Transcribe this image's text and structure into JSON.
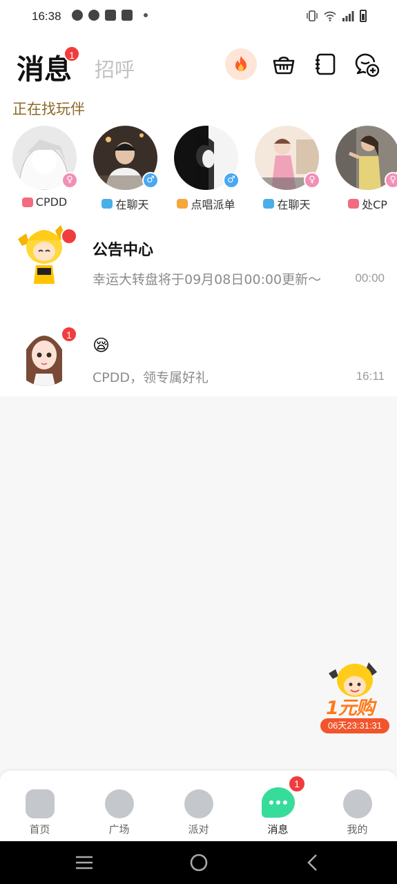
{
  "status_bar": {
    "time": "16:38"
  },
  "header": {
    "active_tab": "消息",
    "active_tab_badge": "1",
    "inactive_tab": "招呼",
    "icons": [
      "fire-icon",
      "basket-icon",
      "contacts-book-icon",
      "add-chat-icon"
    ]
  },
  "partners": {
    "title": "正在找玩伴",
    "items": [
      {
        "status": "CPDD",
        "status_icon": "cp-heart-icon",
        "gender": "female",
        "gender_color": "#f28fb6"
      },
      {
        "status": "在聊天",
        "status_icon": "chat-bubble-icon",
        "gender": "male",
        "gender_color": "#49a8f2"
      },
      {
        "status": "点唱派单",
        "status_icon": "mic-icon",
        "gender": "male",
        "gender_color": "#49a8f2"
      },
      {
        "status": "在聊天",
        "status_icon": "chat-bubble-icon",
        "gender": "female",
        "gender_color": "#f28fb6"
      },
      {
        "status": "处CP",
        "status_icon": "cp-heart-icon",
        "gender": "female",
        "gender_color": "#f28fb6"
      }
    ]
  },
  "messages": [
    {
      "title": "公告中心",
      "preview": "幸运大转盘将于09月08日00:00更新～",
      "time": "00:00",
      "badge": ""
    },
    {
      "title": "😪",
      "preview": "CPDD，领专属好礼",
      "time": "16:11",
      "badge": "1"
    }
  ],
  "promo": {
    "text": "1元购",
    "timer": "06天23:31:31"
  },
  "bottom_nav": [
    {
      "label": "首页",
      "icon": "gamepad-icon"
    },
    {
      "label": "广场",
      "icon": "sparkle-icon"
    },
    {
      "label": "派对",
      "icon": "planet-icon"
    },
    {
      "label": "消息",
      "icon": "message-icon",
      "badge": "1"
    },
    {
      "label": "我的",
      "icon": "face-icon"
    }
  ],
  "colors": {
    "accent_green": "#37dc9a",
    "badge_red": "#f03c3c",
    "partners_title": "#8a6a28"
  }
}
